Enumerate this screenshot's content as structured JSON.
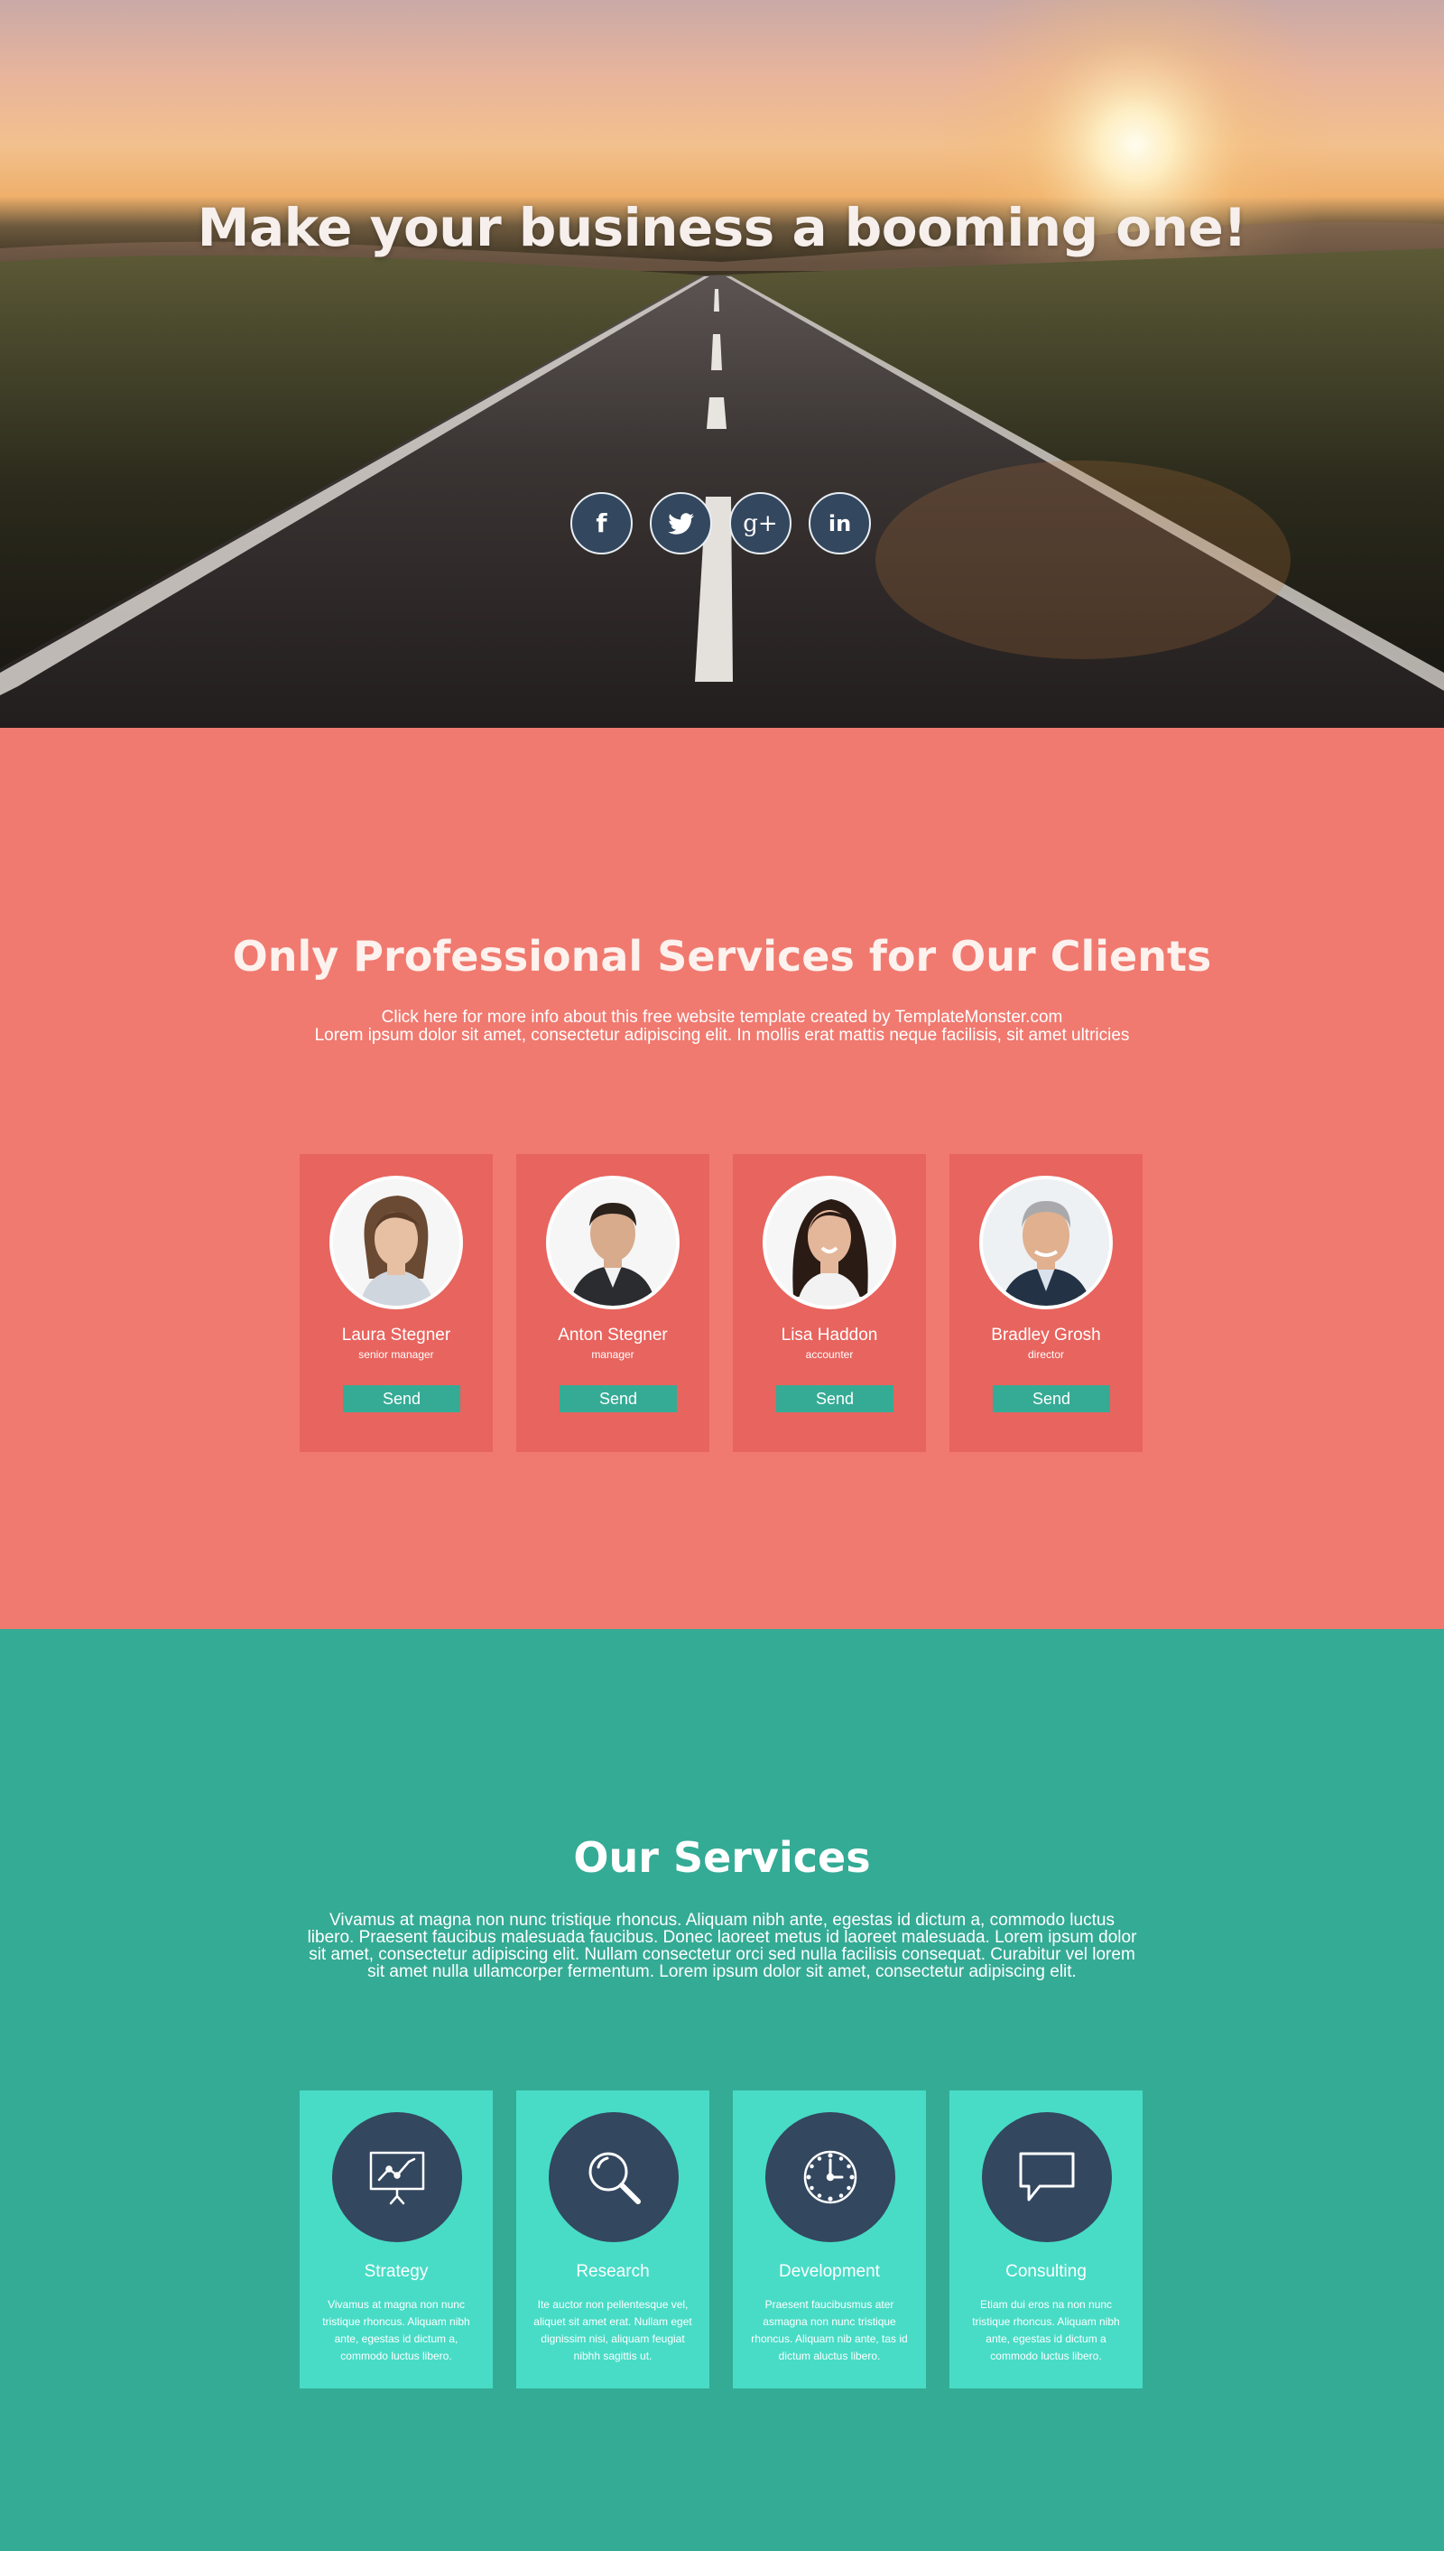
{
  "hero": {
    "title": "Make your business a booming one!",
    "social": [
      {
        "icon": "facebook-icon",
        "glyph": "f"
      },
      {
        "icon": "twitter-icon",
        "glyph": "t"
      },
      {
        "icon": "google-plus-icon",
        "glyph": "g+"
      },
      {
        "icon": "linkedin-icon",
        "glyph": "in"
      }
    ]
  },
  "team": {
    "title": "Only Professional Services for Our Clients",
    "link_text": "Click here for more info about this free website template created by TemplateMonster.com",
    "intro": "Lorem ipsum dolor sit amet, consectetur adipiscing elit. In mollis erat mattis neque facilisis, sit amet ultricies",
    "members": [
      {
        "name": "Laura Stegner",
        "role": "senior manager",
        "button": "Send"
      },
      {
        "name": "Anton Stegner",
        "role": "manager",
        "button": "Send"
      },
      {
        "name": "Lisa Haddon",
        "role": "accounter",
        "button": "Send"
      },
      {
        "name": "Bradley Grosh",
        "role": "director",
        "button": "Send"
      }
    ]
  },
  "services": {
    "title": "Our Services",
    "text": "Vivamus at magna non nunc tristique rhoncus. Aliquam nibh ante, egestas id dictum a, commodo luctus libero. Praesent faucibus malesuada faucibus. Donec laoreet metus id laoreet malesuada. Lorem ipsum dolor sit amet, consectetur adipiscing elit. Nullam consectetur orci sed nulla facilisis consequat. Curabitur vel lorem sit amet nulla ullamcorper fermentum.  Lorem ipsum dolor sit amet, consectetur adipiscing elit.",
    "items": [
      {
        "title": "Strategy",
        "icon": "presentation-chart-icon",
        "desc": "Vivamus at magna non nunc tristique rhoncus. Aliquam nibh ante, egestas id dictum a, commodo luctus libero."
      },
      {
        "title": "Research",
        "icon": "magnifier-icon",
        "desc": "Ite auctor non pellentesque vel, aliquet sit amet erat. Nullam eget dignissim nisi, aliquam feugiat nibhh sagittis ut."
      },
      {
        "title": "Development",
        "icon": "clock-icon",
        "desc": "Praesent faucibusmus ater asmagna non nunc tristique rhoncus. Aliquam nib ante, tas id dictum aluctus libero."
      },
      {
        "title": "Consulting",
        "icon": "speech-bubble-icon",
        "desc": "Etiam dui eros na non nunc tristique rhoncus. Aliquam nibh ante, egestas id dictum a commodo luctus libero."
      }
    ]
  },
  "colors": {
    "coral": "#f07a70",
    "coral_card": "#e8645e",
    "teal": "#34ab95",
    "teal_card": "#48dcc6",
    "navy": "#33475f"
  }
}
